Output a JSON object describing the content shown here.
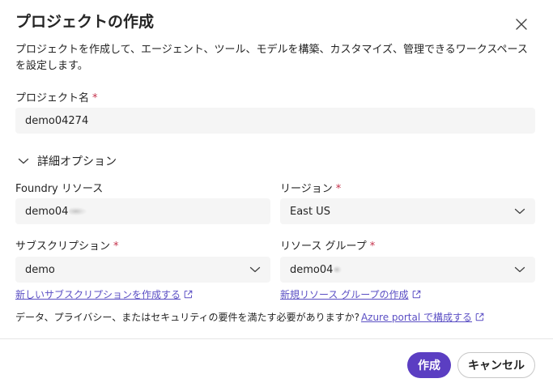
{
  "dialog": {
    "title": "プロジェクトの作成",
    "description": "プロジェクトを作成して、エージェント、ツール、モデルを構築、カスタマイズ、管理できるワークスペースを設定します。"
  },
  "project_name": {
    "label": "プロジェクト名",
    "required_mark": "*",
    "value": "demo04274"
  },
  "advanced": {
    "label": "詳細オプション",
    "expanded": true
  },
  "foundry_resource": {
    "label": "Foundry リソース",
    "value": "demo04"
  },
  "region": {
    "label": "リージョン",
    "required_mark": "*",
    "value": "East US"
  },
  "subscription": {
    "label": "サブスクリプション",
    "required_mark": "*",
    "value": "demo",
    "create_link": "新しいサブスクリプションを作成する"
  },
  "resource_group": {
    "label": "リソース グループ",
    "required_mark": "*",
    "value": "demo04",
    "create_link": "新規リソース グループの作成"
  },
  "footnote": {
    "text": "データ、プライバシー、またはセキュリティの要件を満たす必要がありますか?",
    "link": "Azure portal で構成する"
  },
  "buttons": {
    "create": "作成",
    "cancel": "キャンセル"
  },
  "colors": {
    "primary": "#5b3ec2",
    "link": "#5b4fc4",
    "required": "#c4314b",
    "field_bg": "#f5f5f5"
  }
}
